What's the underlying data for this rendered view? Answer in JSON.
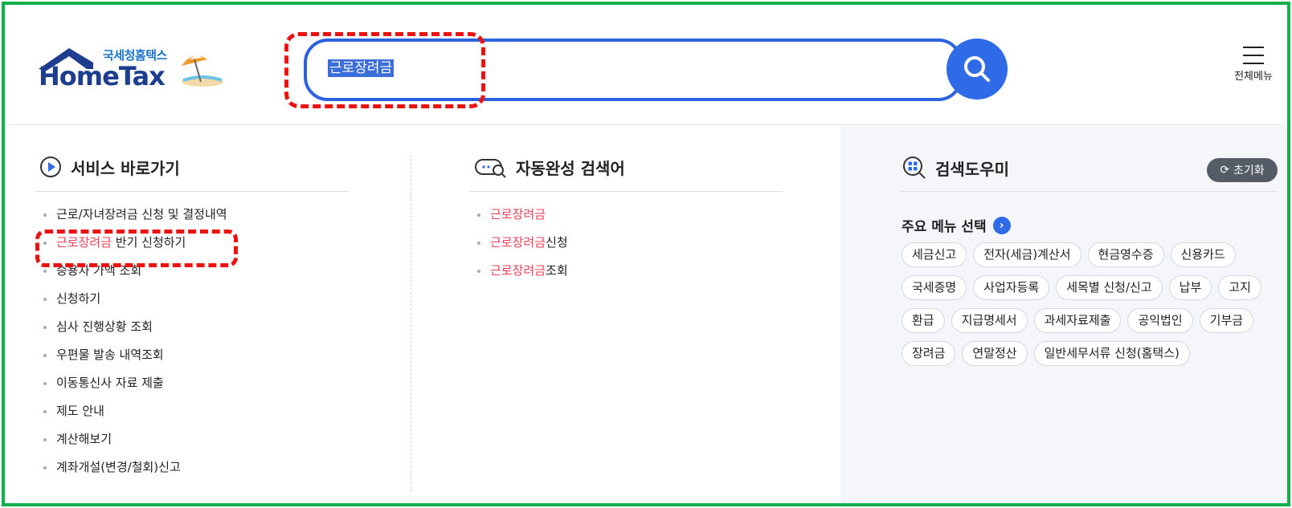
{
  "header": {
    "logo_kr": "국세청홈택스",
    "logo_en": "HomeTax",
    "search_value": "근로장려금",
    "menu_label": "전체메뉴"
  },
  "service_shortcut": {
    "title": "서비스 바로가기",
    "items": [
      {
        "pre": "",
        "hl": "",
        "post": "근로/자녀장려금 신청 및 결정내역"
      },
      {
        "pre": "",
        "hl": "근로장려금",
        "post": " 반기 신청하기"
      },
      {
        "pre": "",
        "hl": "",
        "post": "승용차 가액 조회"
      },
      {
        "pre": "",
        "hl": "",
        "post": "신청하기"
      },
      {
        "pre": "",
        "hl": "",
        "post": "심사 진행상황 조회"
      },
      {
        "pre": "",
        "hl": "",
        "post": "우편물 발송 내역조회"
      },
      {
        "pre": "",
        "hl": "",
        "post": "이동통신사 자료 제출"
      },
      {
        "pre": "",
        "hl": "",
        "post": "제도 안내"
      },
      {
        "pre": "",
        "hl": "",
        "post": "계산해보기"
      },
      {
        "pre": "",
        "hl": "",
        "post": "계좌개설(변경/철회)신고"
      }
    ]
  },
  "autocomplete": {
    "title": "자동완성 검색어",
    "items": [
      {
        "hl": "근로장려금",
        "post": ""
      },
      {
        "hl": "근로장려금",
        "post": "신청"
      },
      {
        "hl": "근로장려금",
        "post": "조회"
      }
    ]
  },
  "helper": {
    "title": "검색도우미",
    "reset_label": "초기화",
    "subtitle": "주요 메뉴 선택",
    "tags": [
      "세금신고",
      "전자(세금)계산서",
      "현금영수증",
      "신용카드",
      "국세증명",
      "사업자등록",
      "세목별 신청/신고",
      "납부",
      "고지",
      "환급",
      "지급명세서",
      "과세자료제출",
      "공익법인",
      "기부금",
      "장려금",
      "연말정산",
      "일반세무서류 신청(홈택스)"
    ]
  },
  "colors": {
    "accent": "#2f6be7",
    "highlight_text": "#e8425a",
    "frame": "#12b04a",
    "annotation": "#ee1111"
  }
}
